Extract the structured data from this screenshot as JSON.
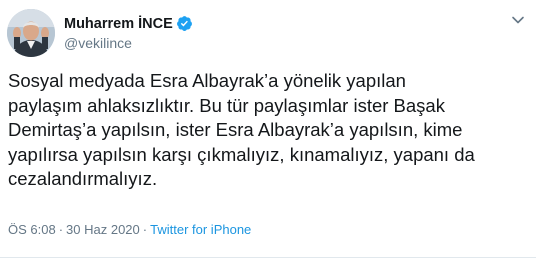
{
  "author": {
    "display_name": "Muharrem İNCE",
    "handle": "@vekilince",
    "verified": true,
    "avatar_icon": "profile-photo-icon"
  },
  "tweet": {
    "text": "Sosyal medyada Esra Albayrak’a yönelik yapılan\npaylaşım ahlaksızlıktır. Bu tür paylaşımlar ister Başak\nDemirtaş’a yapılsın, ister Esra Albayrak’a yapılsın, kime\nyapılırsa yapılsın karşı çıkmalıyız, kınamalıyız, yapanı da\ncezalandırmalıyız."
  },
  "meta": {
    "time": "ÖS 6:08",
    "separator1": "·",
    "date": "30 Haz 2020",
    "separator2": "·",
    "source": "Twitter for iPhone"
  },
  "colors": {
    "text": "#14171a",
    "secondary": "#657786",
    "link": "#1b95e0",
    "verified": "#1da1f2"
  },
  "icons": {
    "verified": "verified-badge-icon",
    "menu": "chevron-down-icon"
  }
}
